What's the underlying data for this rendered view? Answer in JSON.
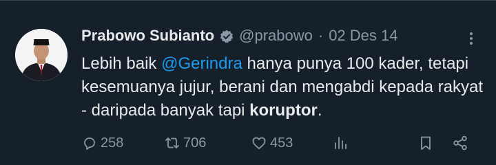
{
  "tweet": {
    "author_name": "Prabowo Subianto",
    "handle": "@prabowo",
    "separator": "·",
    "date": "02 Des 14",
    "text_part1": "Lebih baik ",
    "mention": "@Gerindra",
    "text_part2": " hanya punya 100 kader, tetapi kesemuanya jujur, berani dan mengabdi kepada rakyat - daripada banyak tapi ",
    "text_bold": "koruptor",
    "text_end": "."
  },
  "actions": {
    "replies": "258",
    "retweets": "706",
    "likes": "453"
  },
  "colors": {
    "background": "#15202b",
    "text": "#e7e9ea",
    "muted": "#8b98a5",
    "accent": "#1d9bf0"
  },
  "icons": [
    "verified-badge-icon",
    "more-icon",
    "reply-icon",
    "retweet-icon",
    "like-icon",
    "views-icon",
    "bookmark-icon",
    "share-icon"
  ]
}
